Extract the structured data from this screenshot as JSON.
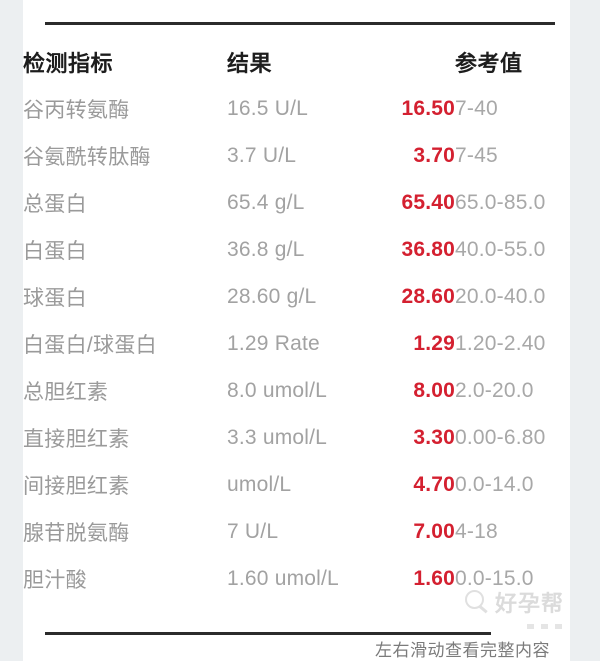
{
  "card": {
    "background_color": "#ffffff",
    "page_background_color": "#eceff1"
  },
  "table": {
    "headers": {
      "name": "检测指标",
      "result": "结果",
      "reference": "参考值"
    },
    "accent_color": "#d42030",
    "muted_color": "#9a9a9a",
    "rows": [
      {
        "name": "谷丙转氨酶",
        "result": "16.5 U/L",
        "value": "16.50",
        "reference": "7-40"
      },
      {
        "name": "谷氨酰转肽酶",
        "result": "3.7 U/L",
        "value": "3.70",
        "reference": "7-45"
      },
      {
        "name": "总蛋白",
        "result": "65.4 g/L",
        "value": "65.40",
        "reference": "65.0-85.0"
      },
      {
        "name": "白蛋白",
        "result": "36.8 g/L",
        "value": "36.80",
        "reference": "40.0-55.0"
      },
      {
        "name": "球蛋白",
        "result": "28.60 g/L",
        "value": "28.60",
        "reference": "20.0-40.0"
      },
      {
        "name": "白蛋白/球蛋白",
        "result": "1.29 Rate",
        "value": "1.29",
        "reference": "1.20-2.40"
      },
      {
        "name": "总胆红素",
        "result": "8.0 umol/L",
        "value": "8.00",
        "reference": "2.0-20.0"
      },
      {
        "name": "直接胆红素",
        "result": "3.3 umol/L",
        "value": "3.30",
        "reference": "0.00-6.80"
      },
      {
        "name": "间接胆红素",
        "result": " umol/L",
        "value": "4.70",
        "reference": "0.0-14.0"
      },
      {
        "name": "腺苷脱氨酶",
        "result": "7 U/L",
        "value": "7.00",
        "reference": "4-18"
      },
      {
        "name": "胆汁酸",
        "result": "1.60 umol/L",
        "value": "1.60",
        "reference": "0.0-15.0"
      }
    ]
  },
  "footer": {
    "swipe_hint": "左右滑动查看完整内容"
  },
  "watermark": {
    "text": "好孕帮",
    "icon": "magnifier-icon"
  }
}
